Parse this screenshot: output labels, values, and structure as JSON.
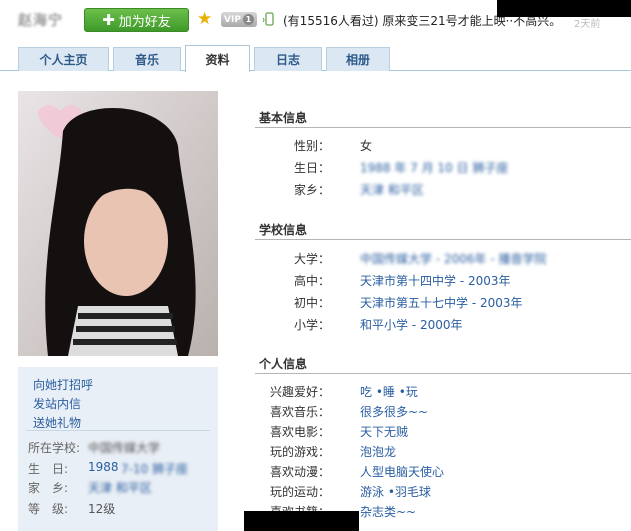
{
  "header": {
    "username": "赵海宁",
    "add_friend_label": "加为好友",
    "vip_label": "VIP",
    "vip_level": "1",
    "status_text": "(有15516人看过) 原来变三21号才能上映··不高兴。",
    "time_text": "2天前"
  },
  "tabs": [
    {
      "label": "个人主页"
    },
    {
      "label": "音乐"
    },
    {
      "label": "资料"
    },
    {
      "label": "日志"
    },
    {
      "label": "相册"
    }
  ],
  "sidebar": {
    "actions": [
      "向她打招呼",
      "发站内信",
      "送她礼物"
    ],
    "school_label": "所在学校:",
    "school_value": "中国传媒大学",
    "birthday_label": "生　日:",
    "birthday_year": "1988",
    "birthday_rest": "7-10 狮子座",
    "hometown_label": "家　乡:",
    "hometown_value": "天津 和平区",
    "level_label": "等　级:",
    "level_value": "12级"
  },
  "basic_info": {
    "title": "基本信息",
    "rows": [
      {
        "label": "性别：",
        "value": "女"
      },
      {
        "label": "生日：",
        "value": "1988 年 7 月 10 日 狮子座"
      },
      {
        "label": "家乡：",
        "value": "天津 和平区"
      }
    ]
  },
  "school_info": {
    "title": "学校信息",
    "rows": [
      {
        "label": "大学：",
        "value": "中国传媒大学 - 2006年 - 播音学院"
      },
      {
        "label": "高中：",
        "value": "天津市第十四中学 - 2003年"
      },
      {
        "label": "初中：",
        "value": "天津市第五十七中学 - 2003年"
      },
      {
        "label": "小学：",
        "value": "和平小学 - 2000年"
      }
    ]
  },
  "personal_info": {
    "title": "个人信息",
    "rows": [
      {
        "label": "兴趣爱好：",
        "value": "吃 •睡 •玩"
      },
      {
        "label": "喜欢音乐：",
        "value": "很多很多~~"
      },
      {
        "label": "喜欢电影：",
        "value": "天下无贼"
      },
      {
        "label": "玩的游戏：",
        "value": "泡泡龙"
      },
      {
        "label": "喜欢动漫：",
        "value": "人型电脑天使心"
      },
      {
        "label": "玩的运动：",
        "value": "游泳 •羽毛球"
      },
      {
        "label": "喜欢书籍：",
        "value": "杂志类~~"
      }
    ]
  },
  "colors": {
    "link": "#2a5ea0",
    "tab_bg": "#dbe8f3",
    "sidebar_bg": "#e9eff6",
    "button_green": "#4fa936"
  }
}
